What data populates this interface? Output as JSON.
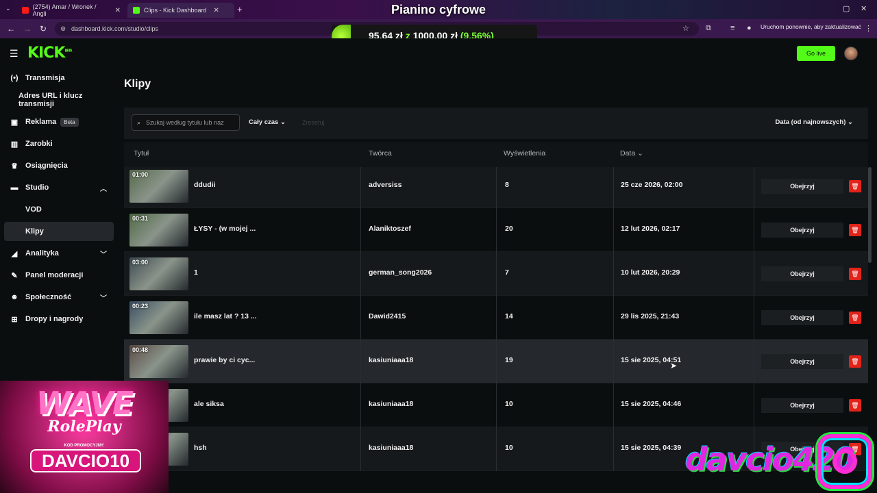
{
  "browser": {
    "tabs": [
      {
        "title": "(2754) Amar / Wronek / Angli",
        "active": false
      },
      {
        "title": "Clips - Kick Dashboard",
        "active": true
      }
    ],
    "url": "dashboard.kick.com/studio/clips",
    "update_text": "Uruchom ponownie, aby zaktualizować"
  },
  "overlay": {
    "stream_title": "Pianino cyfrowe",
    "donation_amount": "95,64 zł",
    "donation_z": "z",
    "donation_goal": "1000,00 zł",
    "donation_pct": "(9.56%)",
    "donation_progress": 0.0956,
    "wave_big": "WAVE",
    "wave_rp": "RolePlay",
    "wave_kod": "KOD PROMOCYJNY:",
    "wave_code": "DAVCIO10",
    "cam_name": "davcio420"
  },
  "header": {
    "logo": "KICK",
    "logo_badge": "BETA",
    "go_live": "Go live"
  },
  "sidebar": {
    "items": [
      {
        "label": "Transmisja",
        "icon": "broadcast-icon"
      },
      {
        "label": "Adres URL i klucz transmisji",
        "icon": ""
      },
      {
        "label": "Reklama",
        "icon": "ad-icon",
        "badge": "Beta"
      },
      {
        "label": "Zarobki",
        "icon": "earnings-icon"
      },
      {
        "label": "Osiągnięcia",
        "icon": "trophy-icon"
      },
      {
        "label": "Studio",
        "icon": "studio-icon"
      },
      {
        "label": "VOD",
        "icon": ""
      },
      {
        "label": "Klipy",
        "icon": ""
      },
      {
        "label": "Analityka",
        "icon": "analytics-icon"
      },
      {
        "label": "Panel moderacji",
        "icon": "wrench-icon"
      },
      {
        "label": "Społeczność",
        "icon": "community-icon"
      },
      {
        "label": "Dropy i nagrody",
        "icon": "drops-icon"
      }
    ]
  },
  "main": {
    "title": "Klipy",
    "search_placeholder": "Szukaj według tytułu lub naz",
    "time_filter": "Cały czas",
    "reset": "Zresetuj",
    "sort": "Data (od najnowszych)",
    "columns": {
      "title": "Tytuł",
      "creator": "Twórca",
      "views": "Wyświetlenia",
      "date": "Data"
    },
    "watch_label": "Obejrzyj",
    "rows": [
      {
        "duration": "01:00",
        "title": "ddudii",
        "creator": "adversiss",
        "views": "8",
        "date": "25 cze 2026, 02:00"
      },
      {
        "duration": "00:31",
        "title": "ŁYSY - (w mojej ...",
        "creator": "Alaniktoszef",
        "views": "20",
        "date": "12 lut 2026, 02:17"
      },
      {
        "duration": "03:00",
        "title": "1",
        "creator": "german_song2026",
        "views": "7",
        "date": "10 lut 2026, 20:29"
      },
      {
        "duration": "00:23",
        "title": "ile masz lat ? 13 ...",
        "creator": "Dawid2415",
        "views": "14",
        "date": "29 lis 2025, 21:43"
      },
      {
        "duration": "00:48",
        "title": "prawie by ci cyc...",
        "creator": "kasiuniaaa18",
        "views": "19",
        "date": "15 sie 2025, 04:51"
      },
      {
        "duration": "",
        "title": "ale siksa",
        "creator": "kasiuniaaa18",
        "views": "10",
        "date": "15 sie 2025, 04:46"
      },
      {
        "duration": "",
        "title": "hsh",
        "creator": "kasiuniaaa18",
        "views": "10",
        "date": "15 sie 2025, 04:39"
      }
    ]
  }
}
